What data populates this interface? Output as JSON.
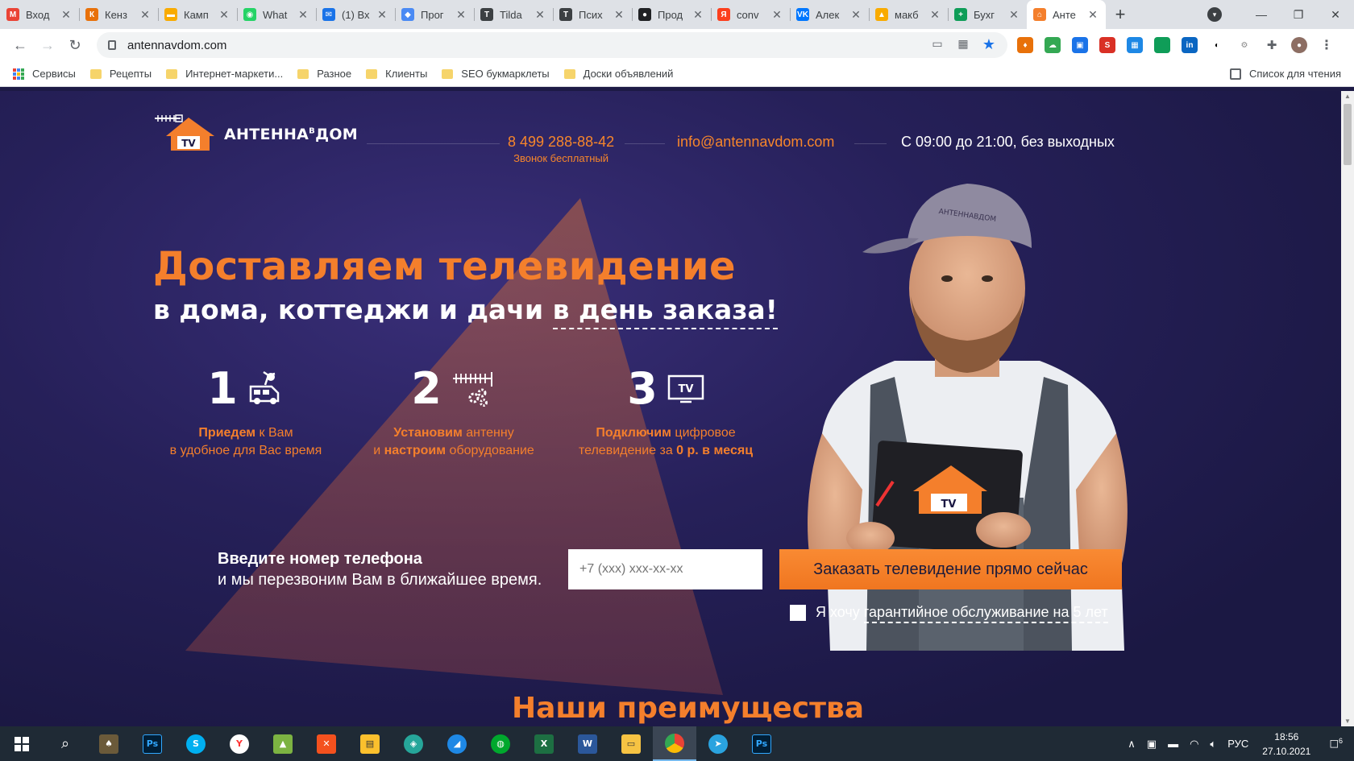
{
  "browser": {
    "tabs": [
      {
        "title": "Вход",
        "color": "#ea4335",
        "glyph": "M"
      },
      {
        "title": "Кенз",
        "color": "#e8710a",
        "glyph": "К"
      },
      {
        "title": "Камп",
        "color": "#f9ab00",
        "glyph": "▬"
      },
      {
        "title": "What",
        "color": "#25d366",
        "glyph": "◉"
      },
      {
        "title": "(1) Вх",
        "color": "#1a73e8",
        "glyph": "✉"
      },
      {
        "title": "Прог",
        "color": "#4a8af4",
        "glyph": "◆"
      },
      {
        "title": "Tilda",
        "color": "#3c4043",
        "glyph": "T"
      },
      {
        "title": "Псих",
        "color": "#3c4043",
        "glyph": "T"
      },
      {
        "title": "Прод",
        "color": "#202124",
        "glyph": "●"
      },
      {
        "title": "conv",
        "color": "#fc3f1d",
        "glyph": "Я"
      },
      {
        "title": "Алек",
        "color": "#0077ff",
        "glyph": "VK"
      },
      {
        "title": "макб",
        "color": "#f9ab00",
        "glyph": "▲"
      },
      {
        "title": "Бухг",
        "color": "#0f9d58",
        "glyph": "+"
      },
      {
        "title": "Анте",
        "color": "#f47f2c",
        "glyph": "⌂",
        "active": true
      }
    ],
    "new_tab_label": "+",
    "window_controls": {
      "minimize": "—",
      "maximize": "❐",
      "close": "✕"
    },
    "nav": {
      "back": "←",
      "forward": "→",
      "reload": "↻"
    },
    "url": "antennavdom.com",
    "menu": "⋮",
    "bookmarks": [
      "Сервисы",
      "Рецепты",
      "Интернет-маркети...",
      "Разное",
      "Клиенты",
      "SEO букмарклеты",
      "Доски объявлений"
    ],
    "reading_list": "Список для чтения"
  },
  "site": {
    "brand": "АНТЕННА",
    "brand_v": "В",
    "brand_end": "ДОМ",
    "logo_tv": "TV",
    "phone": "8 499 288-88-42",
    "phone_note": "Звонок бесплатный",
    "email": "info@antennavdom.com",
    "hours": "С 09:00 до 21:00, без выходных",
    "headline": "Доставляем телевидение",
    "subheadline_a": "в дома, коттеджи и дачи ",
    "subheadline_b": "в день заказа!",
    "steps": [
      {
        "num": "1",
        "bold1": "Приедем",
        "text1": " к Вам",
        "text2": "в удобное для Вас время"
      },
      {
        "num": "2",
        "bold1": "Установим",
        "text1": " антенну",
        "text2a": "и ",
        "bold2": "настроим",
        "text2b": " оборудование"
      },
      {
        "num": "3",
        "bold1": "Подключим",
        "text1": " цифровое",
        "text2a": "телевидение за ",
        "bold2": "0 р. в месяц"
      }
    ],
    "callout_line1": "Введите номер телефона",
    "callout_line2": "и мы перезвоним Вам в ближайшее время.",
    "phone_placeholder": "+7 (xxx) xxx-xx-xx",
    "cta_label": "Заказать телевидение прямо сейчас",
    "warranty_a": "Я хочу ",
    "warranty_b": "гарантийное обслуживание на 5 лет",
    "advantages_title": "Наши преимущества",
    "cap_text": "АНТЕННАВДОМ",
    "clipboard_tv": "TV",
    "accent": "#f47f2c"
  },
  "taskbar": {
    "lang": "РУС",
    "time": "18:56",
    "date": "27.10.2021",
    "notifications": "6"
  }
}
